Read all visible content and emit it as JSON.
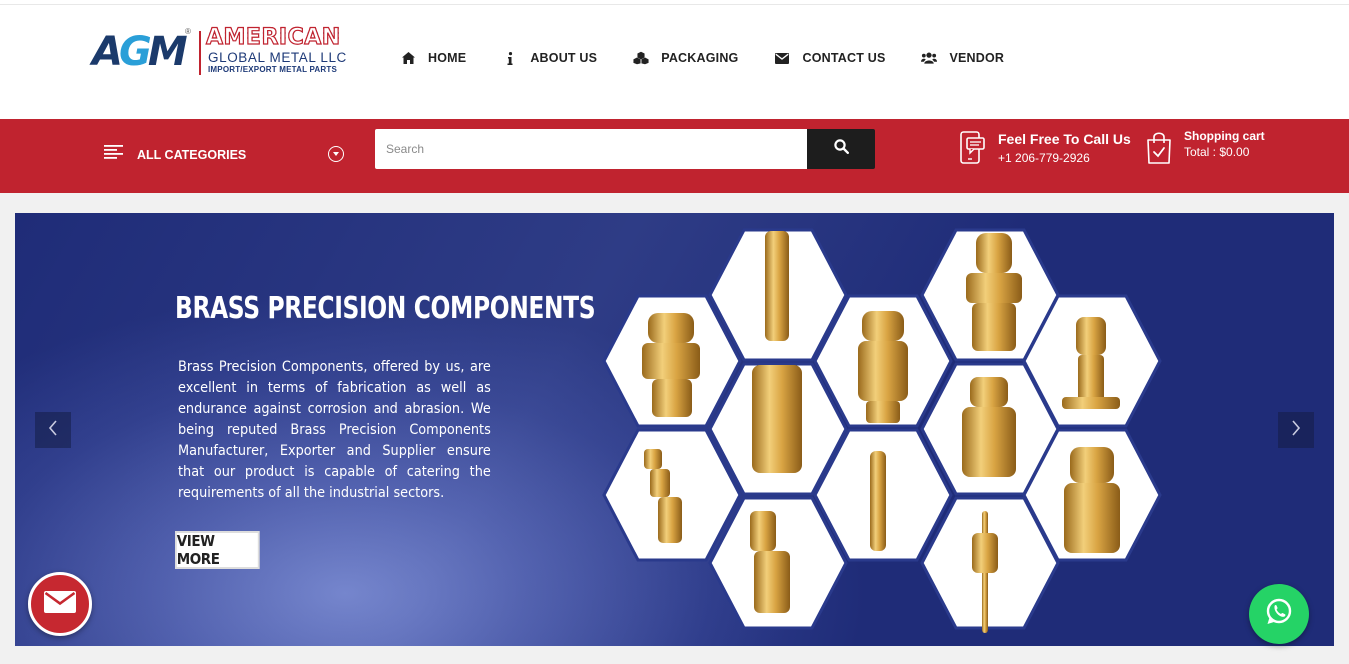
{
  "brand": {
    "logo_mark": "AGM",
    "registered": "®",
    "name_line1": "AMERICAN",
    "name_line2": "GLOBAL METAL LLC",
    "name_line3": "IMPORT/EXPORT METAL PARTS"
  },
  "nav": {
    "items": [
      {
        "label": "HOME",
        "icon": "home-icon"
      },
      {
        "label": "ABOUT US",
        "icon": "info-icon"
      },
      {
        "label": "PACKAGING",
        "icon": "cubes-icon"
      },
      {
        "label": "CONTACT US",
        "icon": "envelope-icon"
      },
      {
        "label": "VENDOR",
        "icon": "users-icon"
      }
    ]
  },
  "toolbar": {
    "categories_label": "ALL CATEGORIES",
    "search_placeholder": "Search",
    "call_title": "Feel Free To Call Us",
    "call_phone": "+1 206-779-2926",
    "cart_title": "Shopping cart",
    "cart_total": "Total : $0.00"
  },
  "slide": {
    "title_bold": "BRASS",
    "title_rest": "PRECISION COMPONENTS",
    "body": "Brass Precision Components, offered by us, are excellent in terms of fabrication as well as endurance against corrosion and abrasion. We being reputed Brass Precision Components Manufacturer, Exporter and Supplier ensure that our product is capable of catering the requirements of all the industrial sectors.",
    "cta_label": "VIEW MORE"
  },
  "colors": {
    "brand_red": "#c0232f",
    "dark": "#1d1d1d",
    "whatsapp": "#25d366",
    "brass": "#d8a64a"
  }
}
